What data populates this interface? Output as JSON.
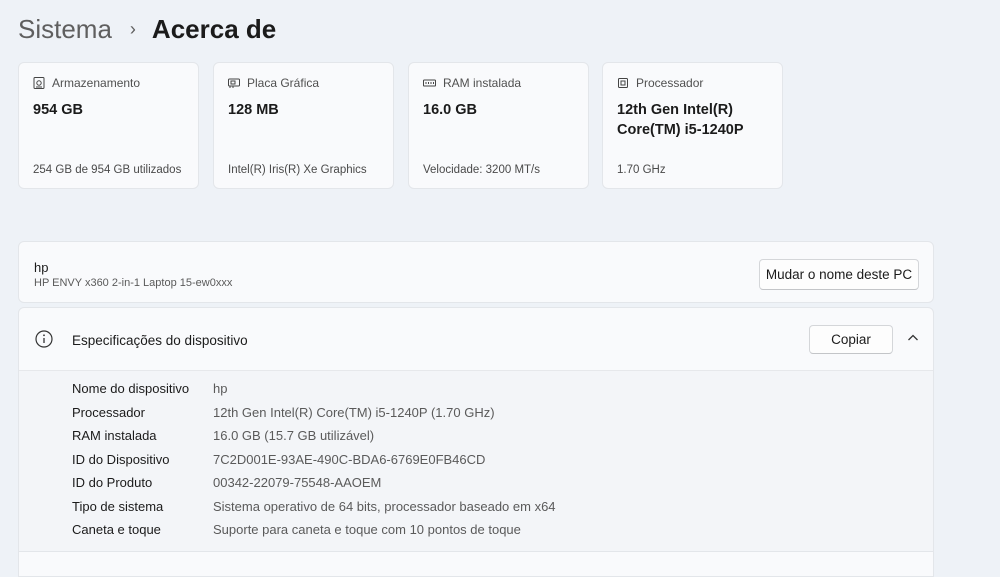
{
  "breadcrumb": {
    "parent": "Sistema",
    "separator": "›",
    "title": "Acerca de"
  },
  "cards": [
    {
      "label": "Armazenamento",
      "icon": "storage-icon",
      "value": "954 GB",
      "detail": "254 GB de 954 GB utilizados"
    },
    {
      "label": "Placa Gráfica",
      "icon": "graphics-card-icon",
      "value": "128 MB",
      "detail": "Intel(R) Iris(R) Xe Graphics"
    },
    {
      "label": "RAM instalada",
      "icon": "ram-icon",
      "value": "16.0 GB",
      "detail": "Velocidade: 3200 MT/s"
    },
    {
      "label": "Processador",
      "icon": "processor-icon",
      "value": "12th Gen Intel(R) Core(TM) i5-1240P",
      "detail": "1.70 GHz"
    }
  ],
  "device": {
    "name": "hp",
    "model": "HP ENVY x360 2-in-1 Laptop 15-ew0xxx",
    "rename_label": "Mudar o nome deste PC"
  },
  "specs": {
    "title": "Especificações do dispositivo",
    "copy_label": "Copiar",
    "rows": [
      {
        "key": "Nome do dispositivo",
        "value": "hp"
      },
      {
        "key": "Processador",
        "value": "12th Gen Intel(R) Core(TM) i5-1240P (1.70 GHz)"
      },
      {
        "key": "RAM instalada",
        "value": "16.0 GB (15.7 GB utilizável)"
      },
      {
        "key": "ID do Dispositivo",
        "value": "7C2D001E-93AE-490C-BDA6-6769E0FB46CD"
      },
      {
        "key": "ID do Produto",
        "value": "00342-22079-75548-AAOEM"
      },
      {
        "key": "Tipo de sistema",
        "value": "Sistema operativo de 64 bits, processador baseado em x64"
      },
      {
        "key": "Caneta e toque",
        "value": "Suporte para caneta e toque com 10 pontos de toque"
      }
    ]
  }
}
